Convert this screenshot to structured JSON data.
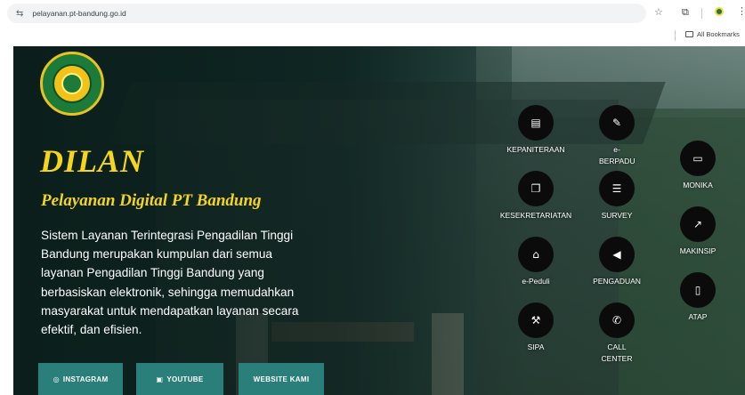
{
  "browser": {
    "url": "pelayanan.pt-bandung.go.id",
    "bookmarks_label": "All Bookmarks",
    "icons": {
      "site_info": "tune-icon",
      "bookmark": "star-icon",
      "extensions": "puzzle-icon",
      "profile": "profile-avatar",
      "menu": "kebab-menu-icon"
    }
  },
  "hero": {
    "title": "DILAN",
    "subtitle": "Pelayanan Digital PT Bandung",
    "description": "Sistem Layanan Terintegrasi Pengadilan Tinggi Bandung merupakan kumpulan dari semua layanan Pengadilan Tinggi Bandung yang berbasiskan elektronik, sehingga memudahkan masyarakat untuk mendapatkan layanan secara efektif, dan efisien.",
    "colors": {
      "accent": "#f5d61c",
      "button": "#2a7f7a",
      "icon_bg": "#0b0b0b"
    }
  },
  "buttons": {
    "instagram": "INSTAGRAM",
    "youtube": "YOUTUBE",
    "website": "WEBSITE KAMI"
  },
  "services": {
    "kepaniteraan": "KEPANITERAAN",
    "e_berpadu": "e-BERPADU",
    "kesekretariatan": "KESEKRETARIATAN",
    "survey": "SURVEY",
    "e_peduli": "e-Peduli",
    "pengaduan": "PENGADUAN",
    "sipa": "SIPA",
    "call_center": "CALL CENTER",
    "monika": "MONIKA",
    "makinsip": "MAKINSIP",
    "atap": "ATAP"
  }
}
